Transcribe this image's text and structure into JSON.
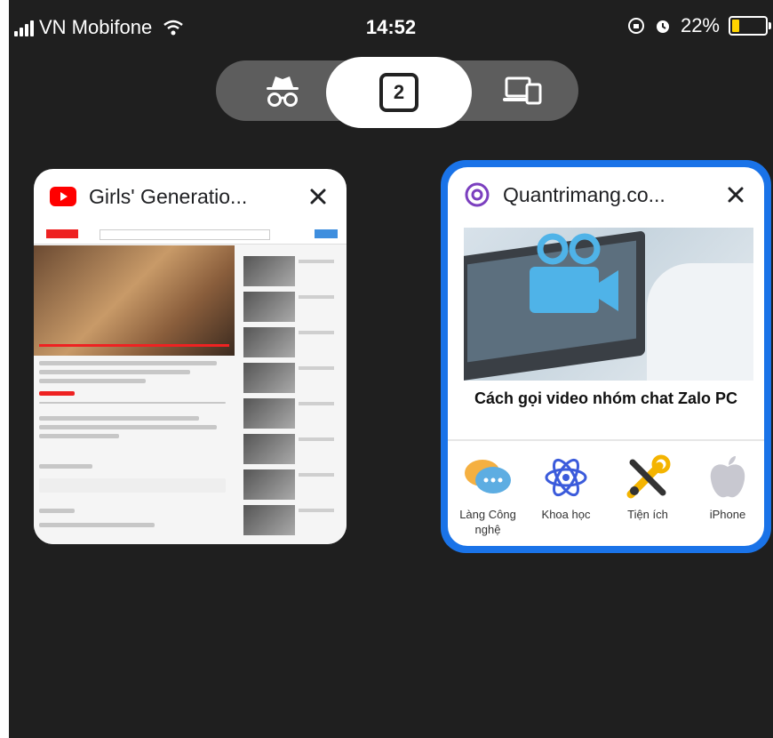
{
  "status_bar": {
    "carrier": "VN Mobifone",
    "time": "14:52",
    "battery": "22%"
  },
  "tab_switcher": {
    "tab_count": "2"
  },
  "tabs": [
    {
      "title": "Girls' Generatio...",
      "favicon": "youtube-icon"
    },
    {
      "title": "Quantrimang.co...",
      "favicon": "quantrimang-icon",
      "selected": true,
      "article_title": "Cách gọi video nhóm chat Zalo PC",
      "categories": [
        {
          "label": "Làng Công nghệ",
          "icon": "chat-bubbles-icon"
        },
        {
          "label": "Khoa học",
          "icon": "atom-icon"
        },
        {
          "label": "Tiện ích",
          "icon": "tools-icon"
        },
        {
          "label": "iPhone",
          "icon": "apple-icon"
        }
      ]
    }
  ],
  "colors": {
    "background": "#1f1f1f",
    "selected_border": "#1a73e8",
    "youtube_red": "#ff0000"
  }
}
